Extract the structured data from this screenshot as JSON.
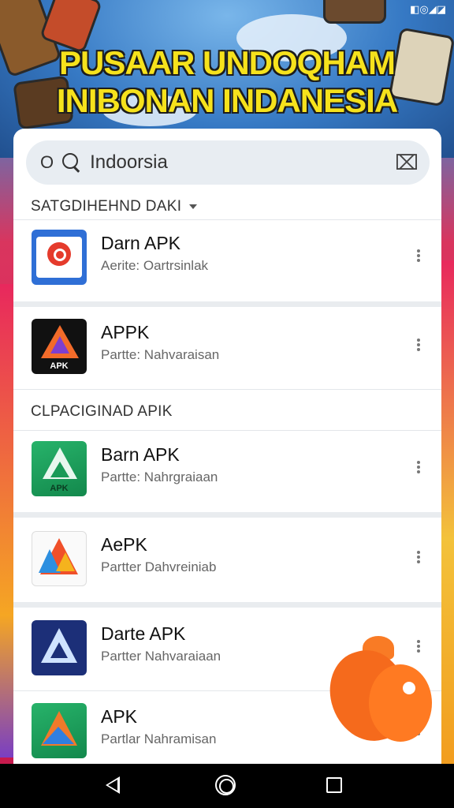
{
  "status_bar": {
    "icons": [
      "sim-icon",
      "alarm-icon",
      "signal-icon",
      "battery-icon"
    ],
    "text": "◧◎◢◪"
  },
  "banner": {
    "line1": "PUSAAR UNDOQHAM",
    "line2": "INIBONAN INDANESIA"
  },
  "search": {
    "prefix": "O",
    "value": "Indoorsia",
    "clear_icon": "⌧"
  },
  "section1": {
    "label": "SATGDIHEHND DAKI"
  },
  "section2": {
    "label": "CLPACIGINAD APIK"
  },
  "apps": [
    {
      "name": "Darn APK",
      "sub": "Aerite: Oartrsinlak",
      "icon": "red-circle-app-icon",
      "icon_label": ""
    },
    {
      "name": "APPK",
      "sub": "Partte: Nahvaraisan",
      "icon": "orange-triangle-app-icon",
      "icon_label": "APK"
    },
    {
      "name": "Barn APK",
      "sub": "Partte: Nahrgraiaan",
      "icon": "green-triangle-app-icon",
      "icon_label": "APK"
    },
    {
      "name": "AePK",
      "sub": "Partter Dahvreiniab",
      "icon": "colorful-triangle-app-icon",
      "icon_label": ""
    },
    {
      "name": "Darte APK",
      "sub": "Partter Nahvaraiaan",
      "icon": "blue-triangle-app-icon",
      "icon_label": ""
    },
    {
      "name": "APK",
      "sub": "Partlar Nahramisan",
      "icon": "green-blue-triangle-app-icon",
      "icon_label": ""
    }
  ],
  "colors": {
    "accent_orange": "#f56a1c",
    "banner_yellow": "#f6e21c",
    "card_bg": "#ffffff"
  }
}
